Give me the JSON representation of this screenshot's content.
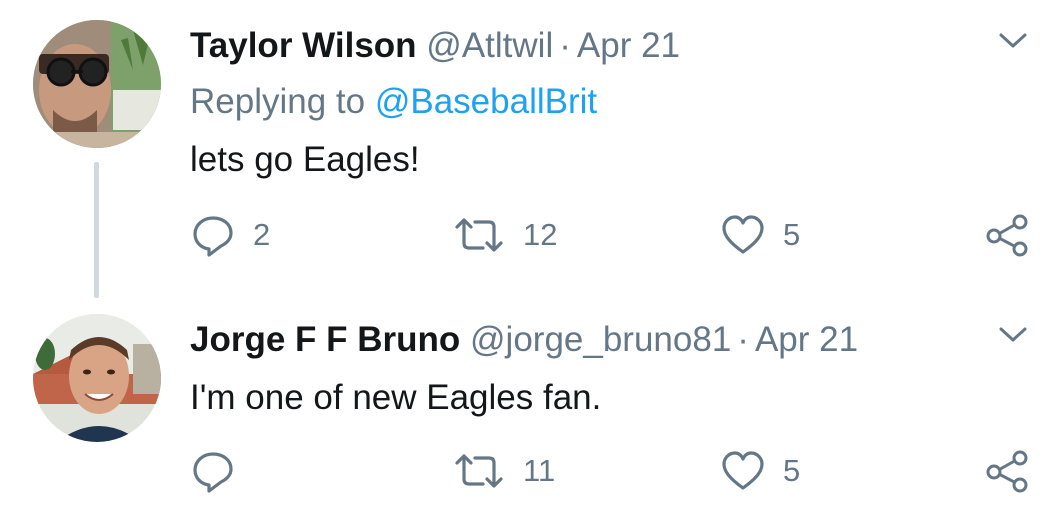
{
  "colors": {
    "text": "#14171a",
    "secondary": "#657786",
    "link": "#1da1f2",
    "thread_line": "#cfd9de"
  },
  "tweets": [
    {
      "name": "Taylor Wilson",
      "handle": "@Atltwil",
      "separator": "·",
      "date": "Apr 21",
      "replying_prefix": "Replying to",
      "replying_to": "@BaseballBrit",
      "text": "lets go Eagles!",
      "reply_count": "2",
      "retweet_count": "12",
      "like_count": "5",
      "icons": [
        "reply-icon",
        "retweet-icon",
        "heart-icon",
        "share-icon",
        "chevron-down-icon"
      ]
    },
    {
      "name": "Jorge F F Bruno",
      "handle": "@jorge_bruno81",
      "separator": "·",
      "date": "Apr 21",
      "text": "I'm one of new Eagles fan.",
      "reply_count": "",
      "retweet_count": "11",
      "like_count": "5",
      "icons": [
        "reply-icon",
        "retweet-icon",
        "heart-icon",
        "share-icon",
        "chevron-down-icon"
      ]
    }
  ]
}
